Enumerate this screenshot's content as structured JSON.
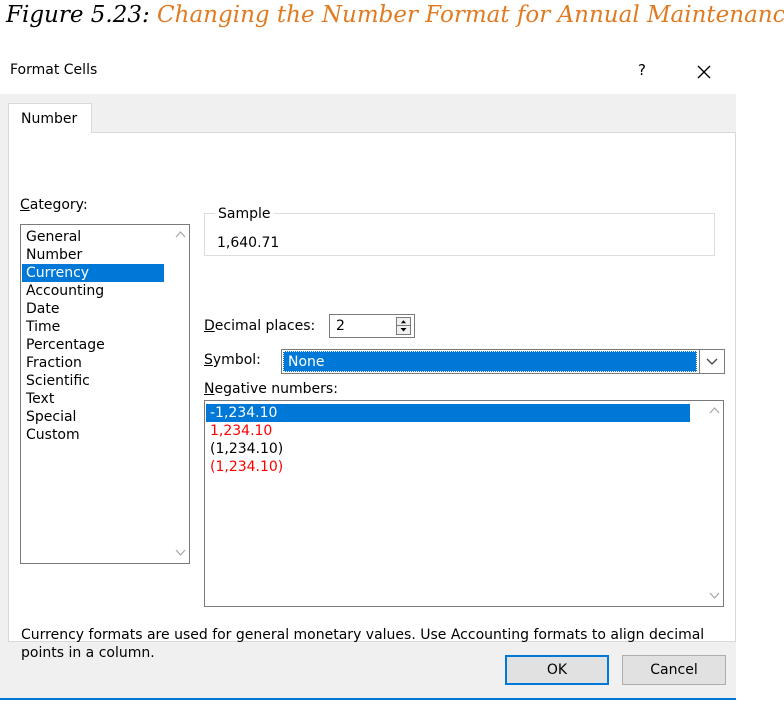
{
  "caption": {
    "prefix": "Figure 5.23:",
    "title": "Changing the Number Format for Annual Maintenance."
  },
  "dialog": {
    "title": "Format Cells",
    "help_glyph": "?",
    "close_icon": "close-icon"
  },
  "tabs": [
    {
      "label": "Number"
    }
  ],
  "category": {
    "label_hotkey": "C",
    "label_rest": "ategory:",
    "items": [
      "General",
      "Number",
      "Currency",
      "Accounting",
      "Date",
      "Time",
      "Percentage",
      "Fraction",
      "Scientific",
      "Text",
      "Special",
      "Custom"
    ],
    "selected": "Currency"
  },
  "sample": {
    "legend": "Sample",
    "value": "1,640.71"
  },
  "decimal_places": {
    "label_hotkey": "D",
    "label_rest": "ecimal places:",
    "value": "2"
  },
  "symbol": {
    "label_hotkey": "S",
    "label_rest": "ymbol:",
    "value": "None"
  },
  "negative_numbers": {
    "label_hotkey": "N",
    "label_rest": "egative numbers:",
    "items": [
      {
        "text": "-1,234.10",
        "color": "#ffffff",
        "selected": true
      },
      {
        "text": "1,234.10",
        "color": "#ff0000",
        "selected": false
      },
      {
        "text": "(1,234.10)",
        "color": "#000000",
        "selected": false
      },
      {
        "text": "(1,234.10)",
        "color": "#ff0000",
        "selected": false
      }
    ]
  },
  "description": "Currency formats are used for general monetary values.  Use Accounting formats to align decimal points in a column.",
  "buttons": {
    "ok": "OK",
    "cancel": "Cancel"
  },
  "colors": {
    "accent": "#0078d7",
    "caption_title": "#e07b22",
    "dialog_bg": "#f0f0f0"
  }
}
